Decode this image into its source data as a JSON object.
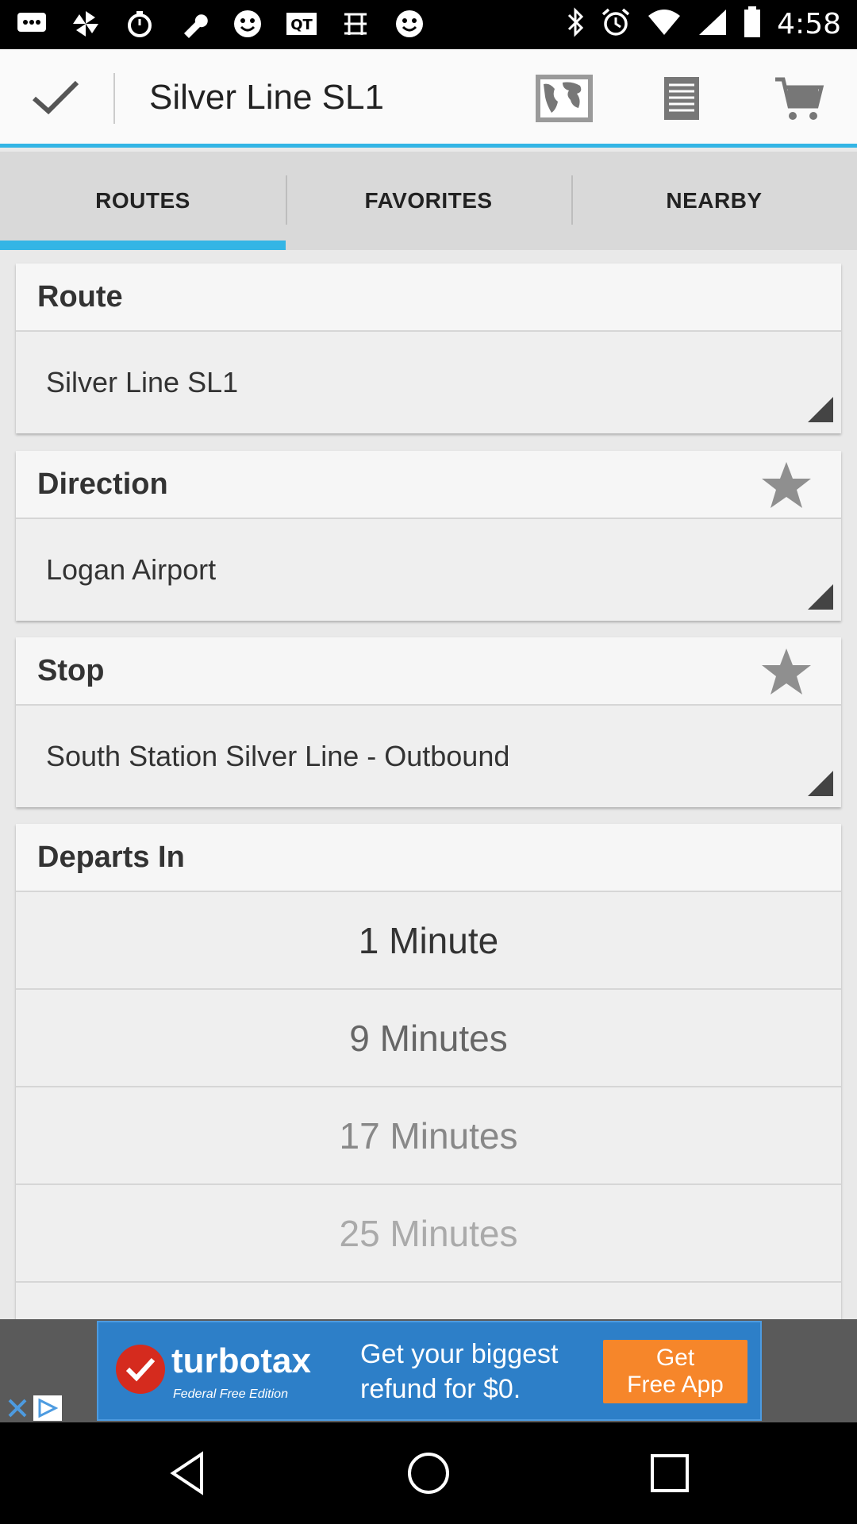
{
  "status_bar": {
    "time": "4:58",
    "left_icons": [
      "chat-icon",
      "pinwheel-icon",
      "timer-icon",
      "wrench-icon",
      "smiley-icon",
      "qt-icon",
      "chinese-icon",
      "smiley-icon"
    ],
    "right_icons": [
      "bluetooth-icon",
      "alarm-icon",
      "wifi-icon",
      "signal-icon",
      "battery-icon"
    ]
  },
  "app_bar": {
    "title": "Silver Line SL1",
    "icons": [
      "check-icon",
      "map-icon",
      "list-icon",
      "cart-icon"
    ],
    "accent_color": "#33b5e5"
  },
  "tabs": [
    {
      "label": "ROUTES",
      "active": true
    },
    {
      "label": "FAVORITES",
      "active": false
    },
    {
      "label": "NEARBY",
      "active": false
    }
  ],
  "route": {
    "header": "Route",
    "selected": "Silver Line SL1"
  },
  "direction": {
    "header": "Direction",
    "selected": "Logan Airport"
  },
  "stop": {
    "header": "Stop",
    "selected": "South Station Silver Line - Outbound"
  },
  "departures": {
    "header": "Departs In",
    "items": [
      "1 Minute",
      "9 Minutes",
      "17 Minutes",
      "25 Minutes"
    ]
  },
  "ad": {
    "brand": "turbotax",
    "sub": "Federal Free Edition",
    "line1": "Get your biggest",
    "line2": "refund for $0.",
    "cta_line1": "Get",
    "cta_line2": "Free App"
  }
}
